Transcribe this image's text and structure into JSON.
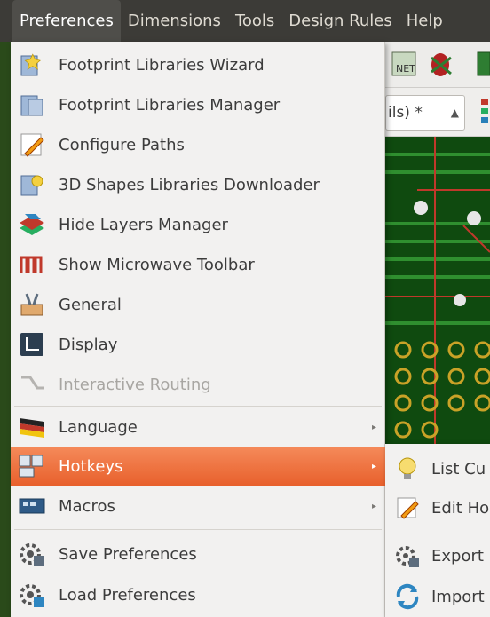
{
  "menubar": {
    "items": [
      "Preferences",
      "Dimensions",
      "Tools",
      "Design Rules",
      "Help"
    ]
  },
  "toolbar": {
    "unit_select": "ils) *"
  },
  "preferences_menu": {
    "items": [
      {
        "label": "Footprint Libraries Wizard",
        "icon": "wizard-icon"
      },
      {
        "label": "Footprint Libraries Manager",
        "icon": "library-manager-icon"
      },
      {
        "label": "Configure Paths",
        "icon": "pencil-icon"
      },
      {
        "label": "3D Shapes Libraries Downloader",
        "icon": "wizard-3d-icon"
      },
      {
        "label": "Hide Layers Manager",
        "icon": "layers-icon"
      },
      {
        "label": "Show Microwave Toolbar",
        "icon": "microwave-icon"
      },
      {
        "label": "General",
        "icon": "tools-icon"
      },
      {
        "label": "Display",
        "icon": "display-icon"
      },
      {
        "label": "Interactive Routing",
        "icon": "routing-icon",
        "disabled": true
      },
      {
        "label": "Language",
        "icon": "flag-icon",
        "submenu": true
      },
      {
        "label": "Hotkeys",
        "icon": "hotkeys-icon",
        "submenu": true,
        "highlight": true
      },
      {
        "label": "Macros",
        "icon": "macros-icon",
        "submenu": true
      },
      {
        "label": "Save Preferences",
        "icon": "save-gear-icon"
      },
      {
        "label": "Load Preferences",
        "icon": "load-gear-icon"
      }
    ]
  },
  "hotkeys_submenu": {
    "items": [
      {
        "label": "List Cu",
        "icon": "lightbulb-icon"
      },
      {
        "label": "Edit Ho",
        "icon": "pencil-icon"
      },
      {
        "label": "Export",
        "icon": "export-gear-icon"
      },
      {
        "label": "Import",
        "icon": "import-refresh-icon"
      }
    ]
  },
  "colors": {
    "highlight": "#e8602c",
    "menubar_bg": "#3c3b37",
    "pcb_bg": "#0f4a0f"
  }
}
